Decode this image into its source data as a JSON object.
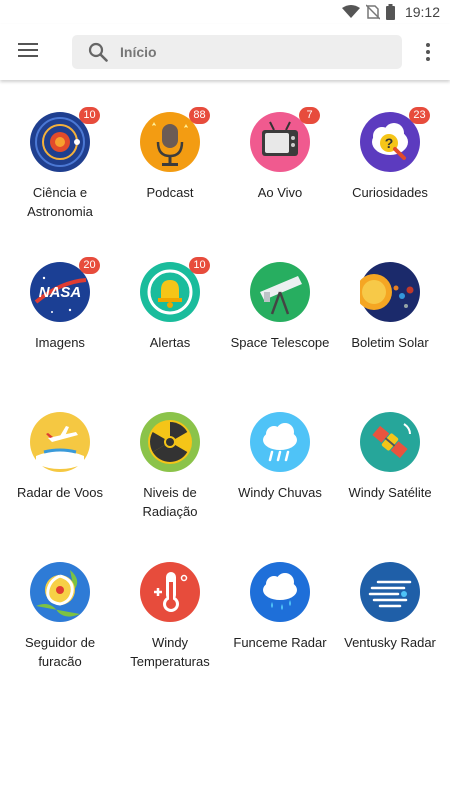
{
  "status_bar": {
    "time": "19:12",
    "icons": [
      "wifi-icon",
      "no-sim-icon",
      "battery-icon"
    ]
  },
  "top_bar": {
    "menu_icon": "hamburger-menu-icon",
    "search": {
      "placeholder": "Início",
      "icon": "search-icon"
    },
    "more_icon": "more-vert-icon"
  },
  "tiles": [
    {
      "label": "Ciência e\nAstronomia",
      "badge": "10",
      "icon": "solar-system-icon"
    },
    {
      "label": "Podcast",
      "badge": "88",
      "icon": "microphone-icon"
    },
    {
      "label": "Ao Vivo",
      "badge": "7",
      "icon": "tv-icon"
    },
    {
      "label": "Curiosidades",
      "badge": "23",
      "icon": "question-cloud-icon"
    },
    {
      "label": "Imagens",
      "badge": "20",
      "icon": "nasa-logo-icon"
    },
    {
      "label": "Alertas",
      "badge": "10",
      "icon": "alarm-bell-icon"
    },
    {
      "label": "Space Telescope",
      "badge": "",
      "icon": "telescope-icon"
    },
    {
      "label": "Boletim Solar",
      "badge": "",
      "icon": "sun-planets-icon"
    },
    {
      "label": "Radar de Voos",
      "badge": "",
      "icon": "airplane-icon"
    },
    {
      "label": "Niveis de\nRadiação",
      "badge": "",
      "icon": "radiation-icon"
    },
    {
      "label": "Windy Chuvas",
      "badge": "",
      "icon": "rain-cloud-icon"
    },
    {
      "label": "Windy Satélite",
      "badge": "",
      "icon": "satellite-icon"
    },
    {
      "label": "Seguidor de\nfuracão",
      "badge": "",
      "icon": "hurricane-icon"
    },
    {
      "label": "Windy\nTemperaturas",
      "badge": "",
      "icon": "thermometer-icon"
    },
    {
      "label": "Funceme Radar",
      "badge": "",
      "icon": "drizzle-cloud-icon"
    },
    {
      "label": "Ventusky Radar",
      "badge": "",
      "icon": "wind-lines-icon"
    }
  ],
  "colors": {
    "badge": "#e74c3c",
    "search_bg": "#eeeeee"
  }
}
